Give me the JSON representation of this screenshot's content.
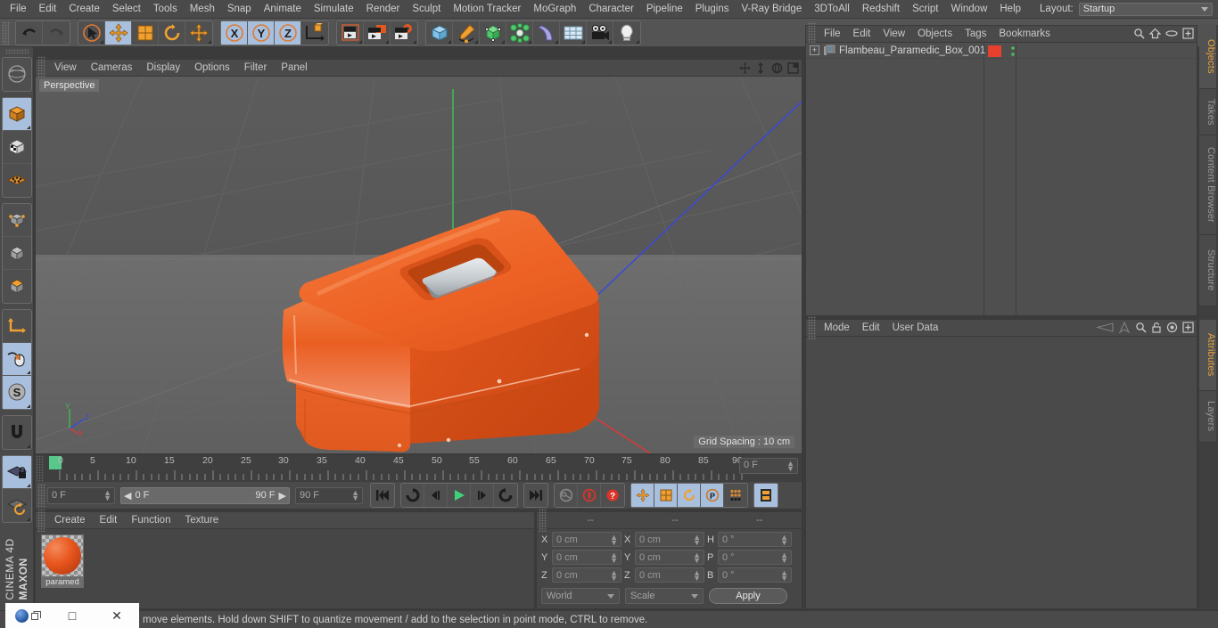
{
  "app": {
    "brand_top": "MAXON",
    "brand_bottom": "CINEMA 4D"
  },
  "menubar": {
    "items": [
      "File",
      "Edit",
      "Create",
      "Select",
      "Tools",
      "Mesh",
      "Snap",
      "Animate",
      "Simulate",
      "Render",
      "Sculpt",
      "Motion Tracker",
      "MoGraph",
      "Character",
      "Pipeline",
      "Plugins",
      "V-Ray Bridge",
      "3DToAll",
      "Redshift",
      "Script",
      "Window",
      "Help"
    ],
    "layout_label": "Layout:",
    "layout_value": "Startup",
    "search_icon": "search-icon"
  },
  "toolbar": {
    "undo": "undo-icon",
    "redo": "redo-icon",
    "live_selection": "live-selection-icon",
    "move": "move-tool-icon",
    "scale": "scale-tool-icon",
    "rotate": "rotate-tool-icon",
    "move_alt": "move-alt-icon",
    "axis_x": "X",
    "axis_y": "Y",
    "axis_z": "Z",
    "world_object": "world-object-axis-icon",
    "render_view": "render-view-icon",
    "render_region": "render-region-icon",
    "render_settings": "render-settings-icon",
    "cube": "primitive-cube-icon",
    "spline_pen": "spline-pen-icon",
    "hyper_nurbs": "generator-icon",
    "array": "deformer-icon",
    "bend": "bend-deformer-icon",
    "floor": "environment-floor-icon",
    "camera": "camera-icon",
    "light": "light-icon"
  },
  "left_toolbar": {
    "items": [
      "undo-view-icon",
      "cube-mode-icon",
      "texture-mode-icon",
      "points-mode-icon",
      "edge-mode-icon",
      "polygon-mode-icon",
      "model-mode-icon",
      "axis-mode-icon",
      "enable-axis-icon",
      "viewport-solo-icon",
      "snap-magnet-icon",
      "workplane-lock-icon",
      "workplane-rotate-icon"
    ]
  },
  "viewport": {
    "menu": [
      "View",
      "Cameras",
      "Display",
      "Options",
      "Filter",
      "Panel"
    ],
    "nav_icons": [
      "pan-icon",
      "dolly-icon",
      "rotate-view-icon",
      "maximize-viewport-icon"
    ],
    "label": "Perspective",
    "grid_spacing": "Grid Spacing : 10 cm",
    "axis_labels": {
      "x": "X",
      "y": "Y",
      "z": "Z"
    },
    "model_color": "#ee6325",
    "handle_color": "#c8ccce"
  },
  "timeline": {
    "ticks": [
      "0",
      "5",
      "10",
      "15",
      "20",
      "25",
      "30",
      "35",
      "40",
      "45",
      "50",
      "55",
      "60",
      "65",
      "70",
      "75",
      "80",
      "85",
      "90"
    ],
    "current_frame_field": "0 F",
    "start_field": "0 F",
    "range_start": "0 F",
    "range_end": "90 F",
    "end_field": "90 F",
    "playhead_frame": 0,
    "transport": [
      "go-to-start-icon",
      "step-back-keyframe-icon",
      "play-reverse-icon",
      "play-icon",
      "play-forward-icon",
      "step-forward-keyframe-icon",
      "go-to-end-icon"
    ],
    "record_group": [
      "autokey-icon",
      "record-active-objects-icon",
      "record-question-icon"
    ],
    "key_group": [
      "key-position-icon",
      "key-scale-icon",
      "key-rotation-icon",
      "key-parameter-icon",
      "key-point-level-icon",
      "timeline-icon"
    ]
  },
  "material_manager": {
    "menu": [
      "Create",
      "Edit",
      "Function",
      "Texture"
    ],
    "materials": [
      {
        "name": "paramed",
        "color": "#e8551c"
      }
    ]
  },
  "coordinates": {
    "headers": [
      "--",
      "--",
      "--"
    ],
    "rows": [
      {
        "pos_label": "X",
        "pos_value": "0 cm",
        "size_label": "X",
        "size_value": "0 cm",
        "rot_label": "H",
        "rot_value": "0 °"
      },
      {
        "pos_label": "Y",
        "pos_value": "0 cm",
        "size_label": "Y",
        "size_value": "0 cm",
        "rot_label": "P",
        "rot_value": "0 °"
      },
      {
        "pos_label": "Z",
        "pos_value": "0 cm",
        "size_label": "Z",
        "size_value": "0 cm",
        "rot_label": "B",
        "rot_value": "0 °"
      }
    ],
    "coord_system": "World",
    "transform_mode": "Scale",
    "apply_label": "Apply"
  },
  "object_manager": {
    "menu": [
      "File",
      "Edit",
      "View",
      "Objects",
      "Tags",
      "Bookmarks"
    ],
    "icons": [
      "search-icon",
      "home-icon",
      "eye-icon",
      "add-layer-icon"
    ],
    "objects": [
      {
        "name": "Flambeau_Paramedic_Box_001",
        "tag_color": "#e8402e",
        "visibility_dots": "visibility-dots-icon"
      }
    ]
  },
  "attributes": {
    "menu": [
      "Mode",
      "Edit",
      "User Data"
    ],
    "icons": [
      "backward-icon",
      "forward-icon",
      "search-icon",
      "lock-icon",
      "target-icon",
      "add-icon"
    ]
  },
  "right_tabs": {
    "upper": [
      "Objects",
      "Takes",
      "Content Browser",
      "Structure"
    ],
    "upper_active": "Objects",
    "lower": [
      "Attributes",
      "Layers"
    ],
    "lower_active": "Attributes"
  },
  "statusbar": {
    "text": "move elements. Hold down SHIFT to quantize movement / add to the selection in point mode, CTRL to remove."
  },
  "window_controls": {
    "minimize": "–",
    "maximize": "□",
    "close": "✕"
  }
}
